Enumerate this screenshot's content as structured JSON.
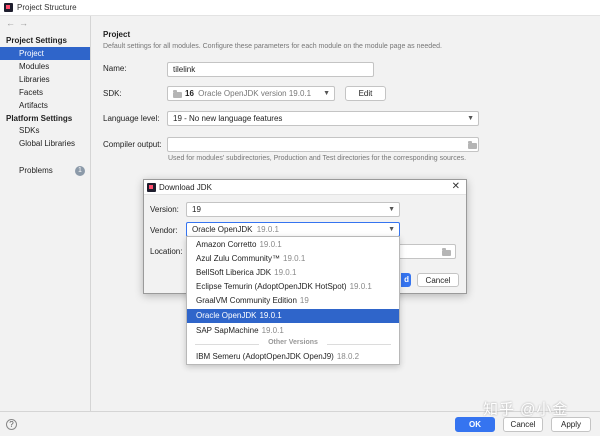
{
  "window": {
    "title": "Project Structure"
  },
  "sidebar": {
    "project_settings_header": "Project Settings",
    "project_settings_items": [
      {
        "label": "Project",
        "selected": true
      },
      {
        "label": "Modules"
      },
      {
        "label": "Libraries"
      },
      {
        "label": "Facets"
      },
      {
        "label": "Artifacts"
      }
    ],
    "platform_settings_header": "Platform Settings",
    "platform_settings_items": [
      {
        "label": "SDKs"
      },
      {
        "label": "Global Libraries"
      }
    ],
    "problems": {
      "label": "Problems",
      "count": "1"
    }
  },
  "main": {
    "heading": "Project",
    "description": "Default settings for all modules. Configure these parameters for each module on the module page as needed.",
    "name_label": "Name:",
    "name_value": "tilelink",
    "sdk_label": "SDK:",
    "sdk_value": "16",
    "sdk_detail": "Oracle OpenJDK version 19.0.1",
    "edit_button": "Edit",
    "language_level_label": "Language level:",
    "language_level_value": "19 - No new language features",
    "compiler_output_label": "Compiler output:",
    "compiler_output_value": "",
    "compiler_output_hint": "Used for modules' subdirectories, Production and Test directories for the corresponding sources."
  },
  "footer": {
    "help": "?",
    "ok_button": "OK",
    "cancel_button": "Cancel",
    "apply_button": "Apply",
    "watermark": "知乎 @小金"
  },
  "download_dialog": {
    "title": "Download JDK",
    "close": "✕",
    "version_label": "Version:",
    "version_value": "19",
    "vendor_label": "Vendor:",
    "vendor_name": "Oracle OpenJDK",
    "vendor_version": "19.0.1",
    "location_label": "Location:",
    "ok_partial": "d",
    "cancel_button": "Cancel"
  },
  "vendor_dropdown": {
    "options": [
      {
        "name": "Amazon Corretto",
        "version": "19.0.1"
      },
      {
        "name": "Azul Zulu Community™",
        "version": "19.0.1"
      },
      {
        "name": "BellSoft Liberica JDK",
        "version": "19.0.1"
      },
      {
        "name": "Eclipse Temurin (AdoptOpenJDK HotSpot)",
        "version": "19.0.1"
      },
      {
        "name": "GraalVM Community Edition",
        "version": "19"
      },
      {
        "name": "Oracle OpenJDK",
        "version": "19.0.1",
        "selected": true
      },
      {
        "name": "SAP SapMachine",
        "version": "19.0.1"
      }
    ],
    "separator": "Other Versions",
    "other_options": [
      {
        "name": "IBM Semeru (AdoptOpenJDK OpenJ9)",
        "version": "18.0.2"
      }
    ]
  },
  "colors": {
    "accent": "#2f65ca",
    "primary_button": "#3574f0",
    "background": "#f2f2f2"
  },
  "icons": [
    "app-icon",
    "back-arrow-icon",
    "forward-arrow-icon",
    "folder-icon",
    "close-icon",
    "chevron-down-icon",
    "help-icon"
  ]
}
